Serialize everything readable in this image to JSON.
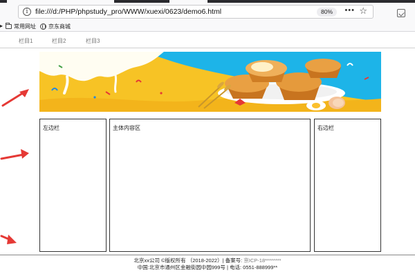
{
  "browser": {
    "url": "file:///d:/PHP/phpstudy_pro/WWW/xuexi/0623/demo6.html",
    "zoom": "80%",
    "more_label": "•••",
    "bookmarks": [
      {
        "label": "常用网址",
        "icon": "folder-icon"
      },
      {
        "label": "京东商城",
        "icon": "globe-icon"
      }
    ]
  },
  "nav": {
    "items": [
      "栏目1",
      "栏目2",
      "栏目3"
    ]
  },
  "layout": {
    "left_label": "左边栏",
    "main_label": "主体内容区",
    "right_label": "右边栏"
  },
  "footer": {
    "line1_prefix": "北京xx公司 ©版权所有 （2018-2022）| 备案号: ",
    "line1_icp": "京ICP-18********",
    "line2": "中国:北京市通州区金融街园中园999号 | 电话: 0551-888999**"
  },
  "colors": {
    "banner_yellow": "#f7c325",
    "arrow_red": "#e53935"
  }
}
